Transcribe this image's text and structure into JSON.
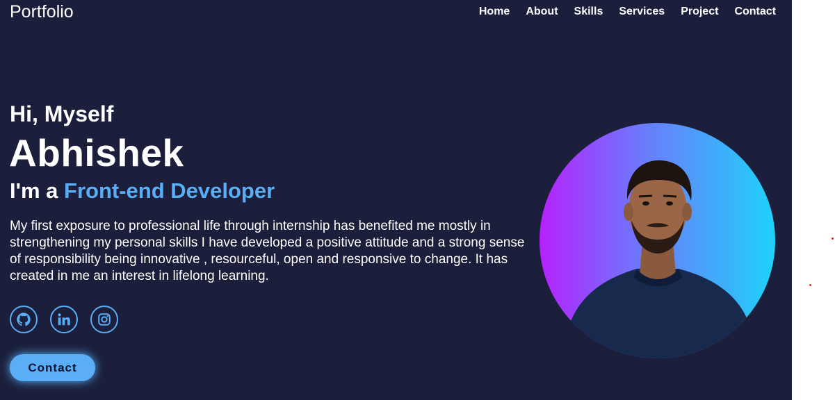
{
  "header": {
    "logo": "Portfolio",
    "nav": [
      "Home",
      "About",
      "Skills",
      "Services",
      "Project",
      "Contact"
    ]
  },
  "hero": {
    "greeting": "Hi, Myself",
    "name": "Abhishek",
    "role_prefix": "I'm a ",
    "role": "Front-end Developer",
    "description": "My first exposure to professional life through internship has benefited me mostly in strengthening my personal skills I have developed a positive attitude and a strong sense of responsibility being innovative , resourceful, open and responsive to change. It has created in me an interest in lifelong learning.",
    "contact_button": "Contact"
  },
  "socials": [
    {
      "icon": "github-icon"
    },
    {
      "icon": "linkedin-icon"
    },
    {
      "icon": "instagram-icon"
    }
  ],
  "colors": {
    "background": "#1b1f3b",
    "accent": "#5aaef5",
    "gradient": [
      "#b621fe",
      "#1fd1f9"
    ]
  }
}
